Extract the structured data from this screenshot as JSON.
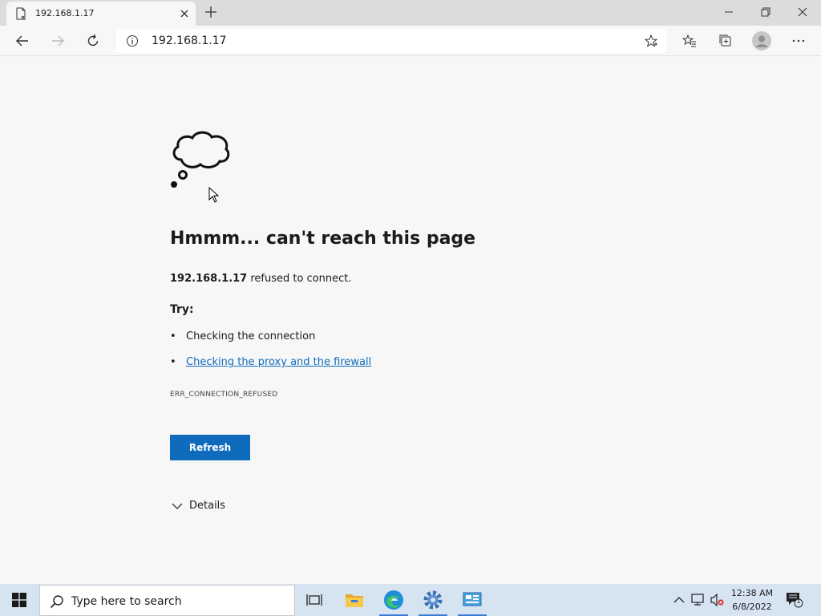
{
  "browser": {
    "tab_title": "192.168.1.17",
    "url": "192.168.1.17"
  },
  "page": {
    "heading": "Hmmm... can't reach this page",
    "host": "192.168.1.17",
    "refused_text": " refused to connect.",
    "try_label": "Try:",
    "suggestions": [
      "Checking the connection",
      "Checking the proxy and the firewall"
    ],
    "error_code": "ERR_CONNECTION_REFUSED",
    "refresh_label": "Refresh",
    "details_label": "Details"
  },
  "taskbar": {
    "search_placeholder": "Type here to search",
    "time": "12:38 AM",
    "date": "6/8/2022",
    "notification_count": "1"
  },
  "colors": {
    "accent": "#0f6cbd",
    "taskbar": "#d6e4f2",
    "page_bg": "#f7f7f7"
  },
  "icons": [
    "page-icon",
    "close-icon",
    "plus-icon",
    "minimize-icon",
    "restore-icon",
    "back-arrow-icon",
    "forward-arrow-icon",
    "refresh-icon",
    "info-icon",
    "star-icon",
    "favorites-icon",
    "collections-icon",
    "profile-icon",
    "more-icon",
    "cloud-icon",
    "cursor-icon",
    "chevron-down-icon",
    "windows-logo-icon",
    "search-icon",
    "task-view-icon",
    "folder-icon",
    "edge-icon",
    "settings-gear-icon",
    "network-app-icon",
    "chevron-up-icon",
    "network-icon",
    "volume-muted-icon",
    "notification-icon"
  ]
}
